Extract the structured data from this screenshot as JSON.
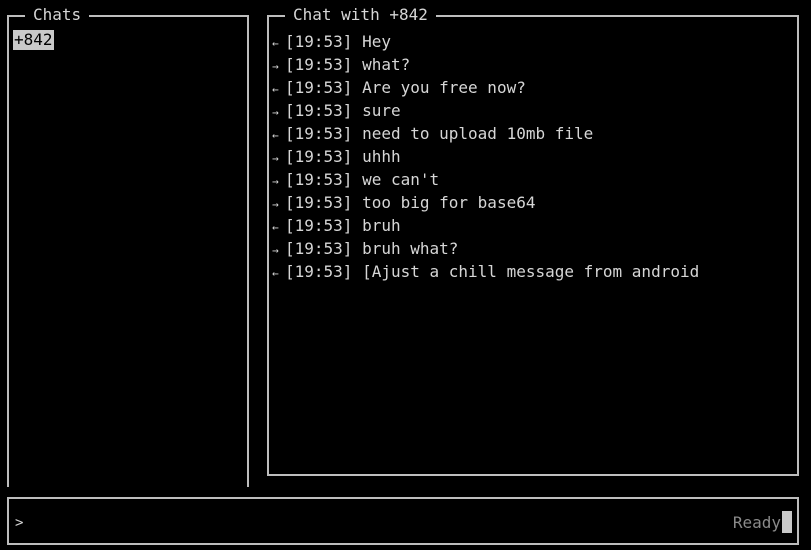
{
  "sidebar": {
    "title": "Chats",
    "items": [
      {
        "label": "+842",
        "selected": true
      }
    ]
  },
  "chat": {
    "title": "Chat with +842",
    "messages": [
      {
        "direction": "in",
        "arrow": "←",
        "time": "[19:53]",
        "text": "Hey"
      },
      {
        "direction": "out",
        "arrow": "→",
        "time": "[19:53]",
        "text": "what?"
      },
      {
        "direction": "in",
        "arrow": "←",
        "time": "[19:53]",
        "text": "Are you free now?"
      },
      {
        "direction": "out",
        "arrow": "→",
        "time": "[19:53]",
        "text": "sure"
      },
      {
        "direction": "in",
        "arrow": "←",
        "time": "[19:53]",
        "text": "need to upload 10mb file"
      },
      {
        "direction": "out",
        "arrow": "→",
        "time": "[19:53]",
        "text": "uhhh"
      },
      {
        "direction": "out",
        "arrow": "→",
        "time": "[19:53]",
        "text": "we can't"
      },
      {
        "direction": "out",
        "arrow": "→",
        "time": "[19:53]",
        "text": "too big for base64"
      },
      {
        "direction": "in",
        "arrow": "←",
        "time": "[19:53]",
        "text": "bruh"
      },
      {
        "direction": "out",
        "arrow": "→",
        "time": "[19:53]",
        "text": "bruh what?"
      },
      {
        "direction": "in",
        "arrow": "←",
        "time": "[19:53]",
        "text": "[Ajust a chill message from android"
      }
    ]
  },
  "input": {
    "prompt": ">",
    "value": "",
    "status": "Ready"
  },
  "colors": {
    "background": "#000000",
    "border": "#bdbdbd",
    "text": "#d6d6d6",
    "status_text": "#8a8a8a",
    "selection_bg": "#c9c9c9"
  }
}
